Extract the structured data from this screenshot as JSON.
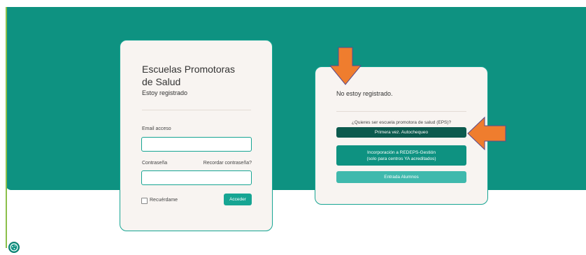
{
  "login": {
    "title": "Escuelas Promotoras de Salud",
    "subtitle": "Estoy registrado",
    "email_label": "Email acceso",
    "password_label": "Contraseña",
    "forgot_link": "Recordar contraseña?",
    "remember_label": "Recuérdame",
    "submit_label": "Acceder"
  },
  "register": {
    "title": "No estoy registrado.",
    "question": "¿Quieres ser escuela promotora de salud (EPS)?",
    "first_time_label": "Primera vez. Autochequeo",
    "incorporation_line1": "Incorporación a REDEPS-Gestión",
    "incorporation_line2": "(solo para centros YA acreditados)",
    "students_label": "Entrada Alumnos"
  },
  "colors": {
    "brand_teal": "#0e9281",
    "dark_teal": "#0c5a4e",
    "light_teal": "#3fb9ad",
    "arrow_orange": "#ef7d2e"
  },
  "icons": {
    "arrow_down": "arrow-down-icon",
    "arrow_left": "arrow-left-icon",
    "cookie": "cookie-icon"
  }
}
